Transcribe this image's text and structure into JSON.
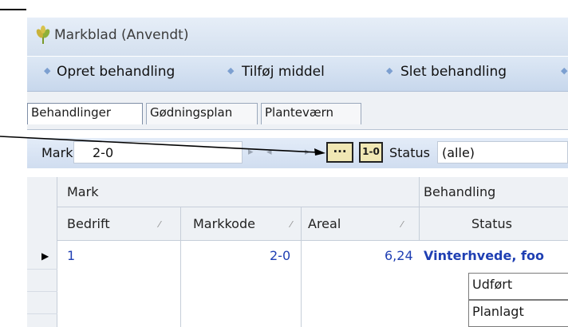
{
  "window": {
    "title": "Markblad (Anvendt)",
    "icon": "wheat-icon"
  },
  "toolbar": {
    "items": [
      {
        "label": "Opret behandling"
      },
      {
        "label": "Tilføj middel"
      },
      {
        "label": "Slet behandling"
      }
    ]
  },
  "tabs": [
    {
      "label": "Behandlinger",
      "active": true
    },
    {
      "label": "Gødningsplan",
      "active": false
    },
    {
      "label": "Planteværn",
      "active": false
    }
  ],
  "filter": {
    "mark_label": "Mark",
    "mark_value": "2-0",
    "ellipsis_label": "···",
    "code_button_label": "1-0",
    "status_label": "Status",
    "status_value": "(alle)"
  },
  "grid": {
    "band_headers": {
      "mark": "Mark",
      "behandling": "Behandling"
    },
    "columns": {
      "bedrift": "Bedrift",
      "markkode": "Markkode",
      "areal": "Areal",
      "status": "Status"
    },
    "row": {
      "bedrift": "1",
      "markkode": "2-0",
      "areal": "6,24",
      "crop": "Vinterhvede, foo"
    },
    "sub_statuses": [
      "Udført",
      "Planlagt"
    ]
  },
  "colors": {
    "accent": "#1f3fb3",
    "toolbar_bg": "#c7d7ec"
  }
}
